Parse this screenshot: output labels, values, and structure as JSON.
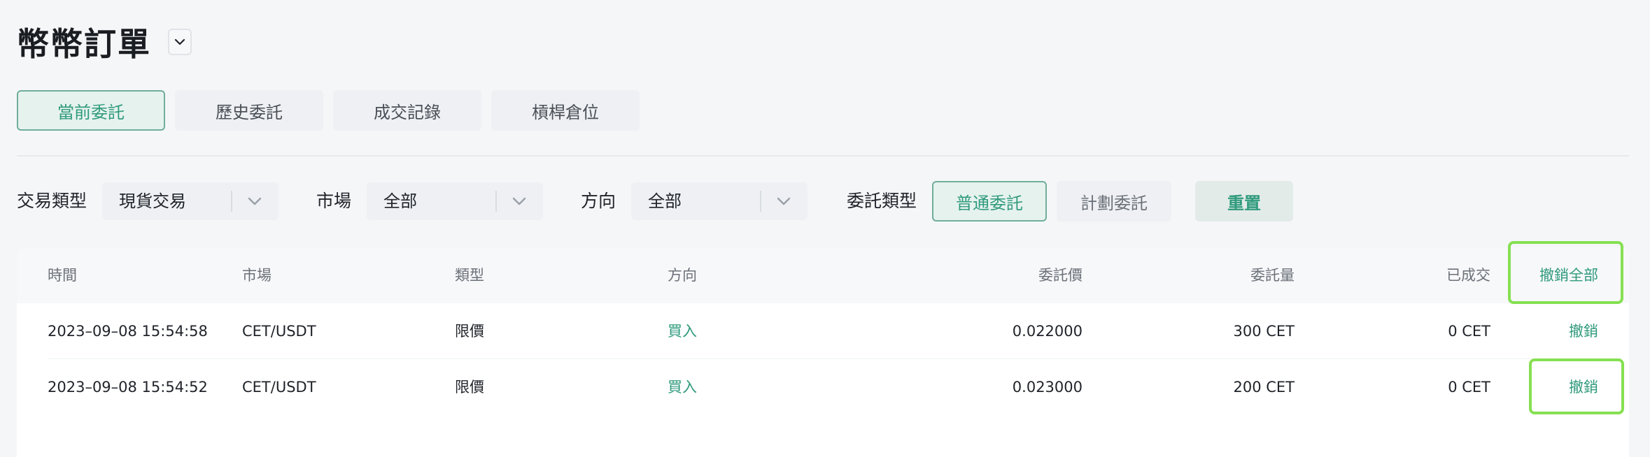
{
  "page": {
    "title": "幣幣訂單"
  },
  "tabs": [
    {
      "label": "當前委託",
      "active": true
    },
    {
      "label": "歷史委託",
      "active": false
    },
    {
      "label": "成交記錄",
      "active": false
    },
    {
      "label": "槓桿倉位",
      "active": false
    }
  ],
  "filters": {
    "trade_type": {
      "label": "交易類型",
      "value": "現貨交易"
    },
    "market": {
      "label": "市場",
      "value": "全部"
    },
    "direction": {
      "label": "方向",
      "value": "全部"
    },
    "order_type": {
      "label": "委託類型",
      "options": [
        "普通委託",
        "計劃委託"
      ],
      "selected": "普通委託"
    },
    "reset_label": "重置"
  },
  "table": {
    "columns": [
      "時間",
      "市場",
      "類型",
      "方向",
      "委託價",
      "委託量",
      "已成交"
    ],
    "cancel_all_label": "撤銷全部",
    "rows": [
      {
        "time": "2023–09–08 15:54:58",
        "market": "CET/USDT",
        "type": "限價",
        "side": "買入",
        "price": "0.022000",
        "amount": "300 CET",
        "filled": "0 CET",
        "action": "撤銷"
      },
      {
        "time": "2023–09–08 15:54:52",
        "market": "CET/USDT",
        "type": "限價",
        "side": "買入",
        "price": "0.023000",
        "amount": "200 CET",
        "filled": "0 CET",
        "action": "撤銷"
      }
    ]
  },
  "colors": {
    "accent": "#2f9a7c",
    "highlight": "#86e052"
  },
  "icons": {
    "title_dropdown": "chevron-down-icon",
    "select_dropdown": "chevron-down-icon"
  }
}
